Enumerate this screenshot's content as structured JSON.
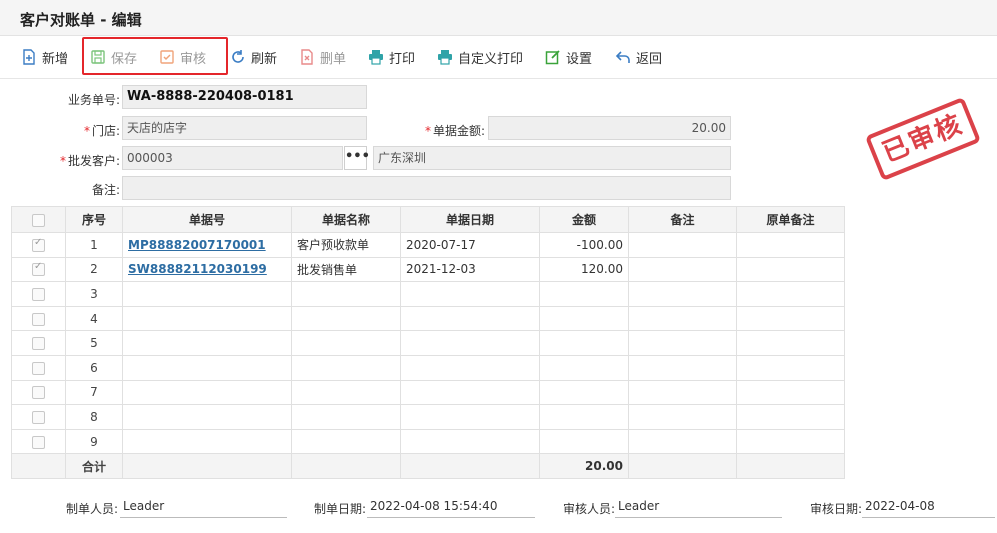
{
  "window": {
    "title": "客户对账单 - 编辑"
  },
  "toolbar": {
    "new": "新增",
    "save": "保存",
    "audit": "审核",
    "refresh": "刷新",
    "delete": "删单",
    "print": "打印",
    "custom_print": "自定义打印",
    "settings": "设置",
    "back": "返回"
  },
  "form": {
    "bill_no_label": "业务单号:",
    "bill_no": "WA-8888-220408-0181",
    "store_label": "门店:",
    "store": "天店的店字",
    "amount_label": "单据金额:",
    "amount": "20.00",
    "customer_label": "批发客户:",
    "customer_code": "000003",
    "customer_name": "广东深圳",
    "note_label": "备注:",
    "note": "",
    "required_mark": "*",
    "more_btn": "•••"
  },
  "stamp": "已审核",
  "table": {
    "headers": [
      "序号",
      "单据号",
      "单据名称",
      "单据日期",
      "金额",
      "备注",
      "原单备注"
    ],
    "rows": [
      {
        "no": "1",
        "doc_no": "MP88882007170001",
        "doc_name": "客户预收款单",
        "date": "2020-07-17",
        "amount": "-100.00",
        "note": "",
        "orig_note": "",
        "checked": true
      },
      {
        "no": "2",
        "doc_no": "SW88882112030199",
        "doc_name": "批发销售单",
        "date": "2021-12-03",
        "amount": "120.00",
        "note": "",
        "orig_note": "",
        "checked": true
      },
      {
        "no": "3",
        "doc_no": "",
        "doc_name": "",
        "date": "",
        "amount": "",
        "note": "",
        "orig_note": "",
        "checked": false
      },
      {
        "no": "4",
        "doc_no": "",
        "doc_name": "",
        "date": "",
        "amount": "",
        "note": "",
        "orig_note": "",
        "checked": false
      },
      {
        "no": "5",
        "doc_no": "",
        "doc_name": "",
        "date": "",
        "amount": "",
        "note": "",
        "orig_note": "",
        "checked": false
      },
      {
        "no": "6",
        "doc_no": "",
        "doc_name": "",
        "date": "",
        "amount": "",
        "note": "",
        "orig_note": "",
        "checked": false
      },
      {
        "no": "7",
        "doc_no": "",
        "doc_name": "",
        "date": "",
        "amount": "",
        "note": "",
        "orig_note": "",
        "checked": false
      },
      {
        "no": "8",
        "doc_no": "",
        "doc_name": "",
        "date": "",
        "amount": "",
        "note": "",
        "orig_note": "",
        "checked": false
      },
      {
        "no": "9",
        "doc_no": "",
        "doc_name": "",
        "date": "",
        "amount": "",
        "note": "",
        "orig_note": "",
        "checked": false
      }
    ],
    "total_label": "合计",
    "total_amount": "20.00"
  },
  "footer": {
    "creator_label": "制单人员:",
    "creator": "Leader",
    "create_date_label": "制单日期:",
    "create_date": "2022-04-08 15:54:40",
    "auditor_label": "审核人员:",
    "auditor": "Leader",
    "audit_date_label": "审核日期:",
    "audit_date": "2022-04-08"
  },
  "colors": {
    "highlight": "#e4262b",
    "stamp": "#d9323a",
    "link": "#2d6da3"
  }
}
